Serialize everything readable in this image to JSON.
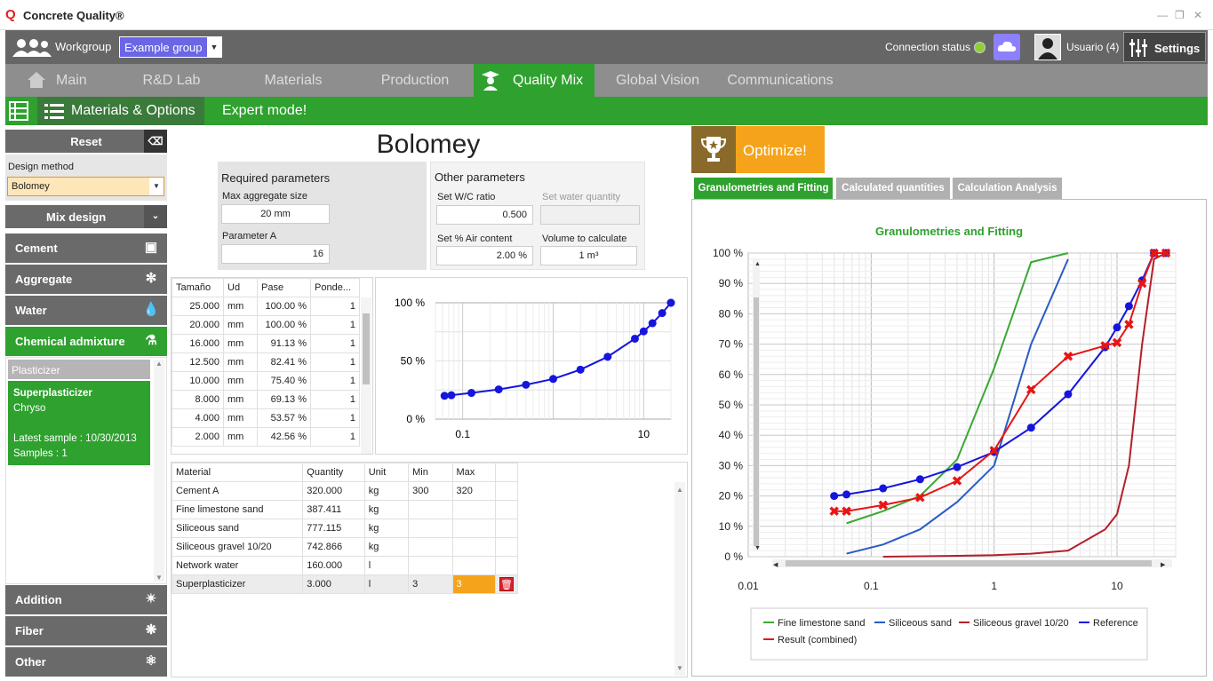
{
  "app": {
    "title": "Concrete Quality®",
    "logo": "Q"
  },
  "topbar": {
    "workgroup_label": "Workgroup",
    "workgroup_value": "Example group",
    "connection_label": "Connection status",
    "user_label": "Usuario (4)",
    "settings_label": "Settings"
  },
  "nav": {
    "tabs": [
      "Main",
      "R&D Lab",
      "Materials",
      "Production",
      "Quality Mix",
      "Global Vision",
      "Communications"
    ],
    "active": "Quality Mix"
  },
  "greenbar": {
    "materials_options": "Materials & Options",
    "expert": "Expert mode!"
  },
  "sidebar": {
    "reset": "Reset",
    "design_method_label": "Design method",
    "design_method_value": "Bolomey",
    "mix_design": "Mix design",
    "cement": "Cement",
    "aggregate": "Aggregate",
    "water": "Water",
    "chemical_admixture": "Chemical admixture",
    "plasticizer": "Plasticizer",
    "card": {
      "name": "Superplasticizer",
      "maker": "Chryso",
      "latest": "Latest sample :  10/30/2013",
      "samples": "Samples :  1"
    },
    "addition": "Addition",
    "fiber": "Fiber",
    "other": "Other"
  },
  "center": {
    "heading": "Bolomey",
    "required": {
      "title": "Required parameters",
      "max_agg_label": "Max aggregate size",
      "max_agg_value": "20 mm",
      "paramA_label": "Parameter A",
      "paramA_value": "16"
    },
    "other": {
      "title": "Other parameters",
      "wc_label": "Set W/C ratio",
      "wc_value": "0.500",
      "water_label": "Set water quantity",
      "air_label": "Set % Air content",
      "air_value": "2.00 %",
      "vol_label": "Volume to calculate",
      "vol_value": "1 m³"
    }
  },
  "sieve_table": {
    "headers": [
      "Tamaño",
      "Ud",
      "Pase",
      "Ponde..."
    ],
    "rows": [
      [
        "25.000",
        "mm",
        "100.00 %",
        "1"
      ],
      [
        "20.000",
        "mm",
        "100.00 %",
        "1"
      ],
      [
        "16.000",
        "mm",
        "91.13 %",
        "1"
      ],
      [
        "12.500",
        "mm",
        "82.41 %",
        "1"
      ],
      [
        "10.000",
        "mm",
        "75.40 %",
        "1"
      ],
      [
        "8.000",
        "mm",
        "69.13 %",
        "1"
      ],
      [
        "4.000",
        "mm",
        "53.57 %",
        "1"
      ],
      [
        "2.000",
        "mm",
        "42.56 %",
        "1"
      ]
    ]
  },
  "small_chart": {
    "ylabels": [
      "100 %",
      "50 %",
      "0 %"
    ],
    "xlabels": [
      "0.1",
      "10"
    ]
  },
  "material_table": {
    "headers": [
      "Material",
      "Quantity",
      "Unit",
      "Min",
      "Max"
    ],
    "rows": [
      [
        "Cement A",
        "320.000",
        "kg",
        "300",
        "320"
      ],
      [
        "Fine limestone sand",
        "387.411",
        "kg",
        "",
        ""
      ],
      [
        "Siliceous sand",
        "777.115",
        "kg",
        "",
        ""
      ],
      [
        "Siliceous gravel 10/20",
        "742.866",
        "kg",
        "",
        ""
      ],
      [
        "Network water",
        "160.000",
        "l",
        "",
        ""
      ],
      [
        "Superplasticizer",
        "3.000",
        "l",
        "3",
        "3"
      ]
    ]
  },
  "right": {
    "optimize": "Optimize!",
    "tabs": [
      "Granulometries and Fitting",
      "Calculated quantities",
      "Calculation Analysis"
    ]
  },
  "chart_data": {
    "type": "line",
    "title": "Granulometries and Fitting",
    "xscale": "log",
    "xlim": [
      0.01,
      30
    ],
    "ylim": [
      0,
      100
    ],
    "xticks": [
      "0.01",
      "0.1",
      "1",
      "10"
    ],
    "yticks": [
      "0 %",
      "10 %",
      "20 %",
      "30 %",
      "40 %",
      "50 %",
      "60 %",
      "70 %",
      "80 %",
      "90 %",
      "100 %"
    ],
    "legend_position": "bottom",
    "series": [
      {
        "name": "Fine limestone sand",
        "color": "#3aa832",
        "marker": "none",
        "x": [
          0.063,
          0.125,
          0.25,
          0.5,
          1,
          2,
          4
        ],
        "y": [
          11,
          15,
          20,
          32,
          62,
          97,
          100
        ]
      },
      {
        "name": "Siliceous sand",
        "color": "#2a5bc4",
        "marker": "none",
        "x": [
          0.063,
          0.125,
          0.25,
          0.5,
          1,
          2,
          4
        ],
        "y": [
          1,
          4,
          9,
          18,
          30,
          70,
          98
        ]
      },
      {
        "name": "Siliceous gravel 10/20",
        "color": "#b3202a",
        "marker": "none",
        "x": [
          0.125,
          0.5,
          1,
          2,
          4,
          8,
          10,
          12.5,
          16,
          20,
          25
        ],
        "y": [
          0,
          0.3,
          0.5,
          1,
          2,
          9,
          14,
          30,
          70,
          98,
          100
        ]
      },
      {
        "name": "Reference",
        "color": "#1515dd",
        "marker": "circle",
        "x": [
          0.05,
          0.063,
          0.125,
          0.25,
          0.5,
          1,
          2,
          4,
          8,
          10,
          12.5,
          16,
          20,
          25
        ],
        "y": [
          20,
          20.5,
          22.5,
          25.5,
          29.5,
          34.5,
          42.5,
          53.5,
          69,
          75.5,
          82.5,
          91,
          100,
          100
        ]
      },
      {
        "name": "Result (combined)",
        "color": "#e81515",
        "marker": "x",
        "x": [
          0.05,
          0.063,
          0.125,
          0.25,
          0.5,
          1,
          2,
          4,
          8,
          10,
          12.5,
          16,
          20,
          25
        ],
        "y": [
          15,
          15,
          17,
          19.5,
          25,
          35,
          55,
          66,
          69.5,
          70.5,
          76.5,
          90,
          100,
          100
        ]
      }
    ]
  },
  "small_chart_data": {
    "type": "scatter",
    "xscale": "log",
    "x": [
      0.063,
      0.075,
      0.125,
      0.25,
      0.5,
      1,
      2,
      4,
      8,
      10,
      12.5,
      16,
      20,
      25
    ],
    "y": [
      20,
      20.5,
      22.5,
      25.5,
      29.5,
      34.5,
      42.5,
      53.57,
      69.13,
      75.4,
      82.41,
      91.13,
      100,
      100
    ]
  },
  "colors": {
    "green": "#2ea12e",
    "orange": "#f5a31a",
    "gray": "#6a6a6a"
  }
}
